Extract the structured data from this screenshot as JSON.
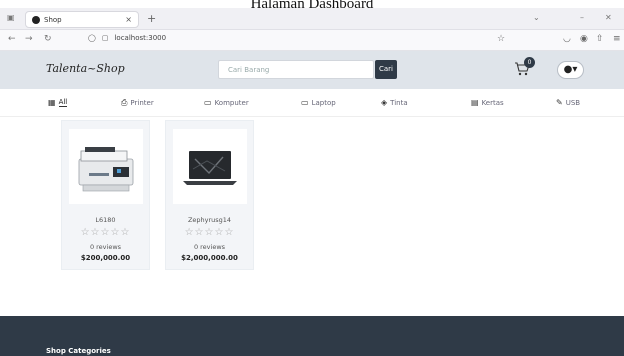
{
  "caption": "Halaman Dashboard",
  "browser": {
    "tab_title": "Shop",
    "tab_close": "×",
    "new_tab": "+",
    "url": "localhost:3000"
  },
  "header": {
    "logo": "Talenta~Shop",
    "search_placeholder": "Cari Barang",
    "search_button": "Cari",
    "cart_count": "0"
  },
  "categories": [
    {
      "label": "All",
      "icon": "grid-icon"
    },
    {
      "label": "Printer",
      "icon": "printer-icon"
    },
    {
      "label": "Komputer",
      "icon": "computer-icon"
    },
    {
      "label": "Laptop",
      "icon": "laptop-icon"
    },
    {
      "label": "Tinta",
      "icon": "ink-icon"
    },
    {
      "label": "Kertas",
      "icon": "paper-icon"
    },
    {
      "label": "USB",
      "icon": "usb-icon"
    }
  ],
  "products": [
    {
      "name": "L6180",
      "stars": "☆☆☆☆☆",
      "reviews": "0 reviews",
      "price": "$200,000.00"
    },
    {
      "name": "Zephyrusg14",
      "stars": "☆☆☆☆☆",
      "reviews": "0 reviews",
      "price": "$2,000,000.00"
    }
  ],
  "footer": {
    "title": "Shop Categories"
  },
  "colors": {
    "header_bg": "#dfe4ea",
    "dark": "#2f3a47"
  }
}
